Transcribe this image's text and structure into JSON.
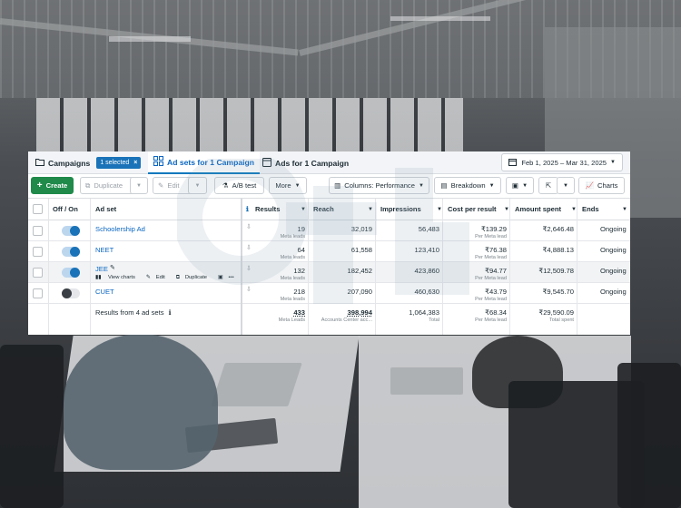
{
  "tabs": {
    "campaigns": "Campaigns",
    "selected": "1 selected",
    "selected_close": "×",
    "adsets": "Ad sets for 1 Campaign",
    "ads": "Ads for 1 Campaign"
  },
  "date_range": "Feb 1, 2025 – Mar 31, 2025",
  "toolbar": {
    "create": "Create",
    "duplicate": "Duplicate",
    "edit": "Edit",
    "ab_test": "A/B test",
    "more": "More",
    "columns": "Columns: Performance",
    "breakdown": "Breakdown",
    "charts": "Charts"
  },
  "columns": {
    "off_on": "Off / On",
    "ad_set": "Ad set",
    "results": "Results",
    "reach": "Reach",
    "impressions": "Impressions",
    "cost_per_result": "Cost per result",
    "amount_spent": "Amount spent",
    "ends": "Ends"
  },
  "row_actions": {
    "view_charts": "View charts",
    "edit": "Edit",
    "duplicate": "Duplicate",
    "more": "•••"
  },
  "rows": [
    {
      "name": "Schoolership Ad",
      "on": true,
      "results": "19",
      "results_sub": "Meta leads",
      "reach": "32,019",
      "impressions": "56,483",
      "cpr": "₹139.29",
      "cpr_sub": "Per Meta lead",
      "spent": "₹2,646.48",
      "ends": "Ongoing"
    },
    {
      "name": "NEET",
      "on": true,
      "results": "64",
      "results_sub": "Meta leads",
      "reach": "61,558",
      "impressions": "123,410",
      "cpr": "₹76.38",
      "cpr_sub": "Per Meta lead",
      "spent": "₹4,888.13",
      "ends": "Ongoing"
    },
    {
      "name": "JEE",
      "on": true,
      "results": "132",
      "results_sub": "Meta leads",
      "reach": "182,452",
      "impressions": "423,860",
      "cpr": "₹94.77",
      "cpr_sub": "Per Meta lead",
      "spent": "₹12,509.78",
      "ends": "Ongoing"
    },
    {
      "name": "CUET",
      "on": false,
      "results": "218",
      "results_sub": "Meta leads",
      "reach": "207,090",
      "impressions": "460,630",
      "cpr": "₹43.79",
      "cpr_sub": "Per Meta lead",
      "spent": "₹9,545.70",
      "ends": "Ongoing"
    }
  ],
  "footer": {
    "label": "Results from 4 ad sets",
    "results": "433",
    "results_sub": "Meta Leads",
    "reach": "398,994",
    "reach_sub": "Accounts Center acc...",
    "impressions": "1,064,383",
    "impressions_sub": "Total",
    "cpr": "₹68.34",
    "cpr_sub": "Per Meta lead",
    "spent": "₹29,590.09",
    "spent_sub": "Total spent"
  },
  "colors": {
    "primary_blue": "#1a73b8",
    "create_green": "#1f8a4a",
    "link_blue": "#0a66c2"
  }
}
